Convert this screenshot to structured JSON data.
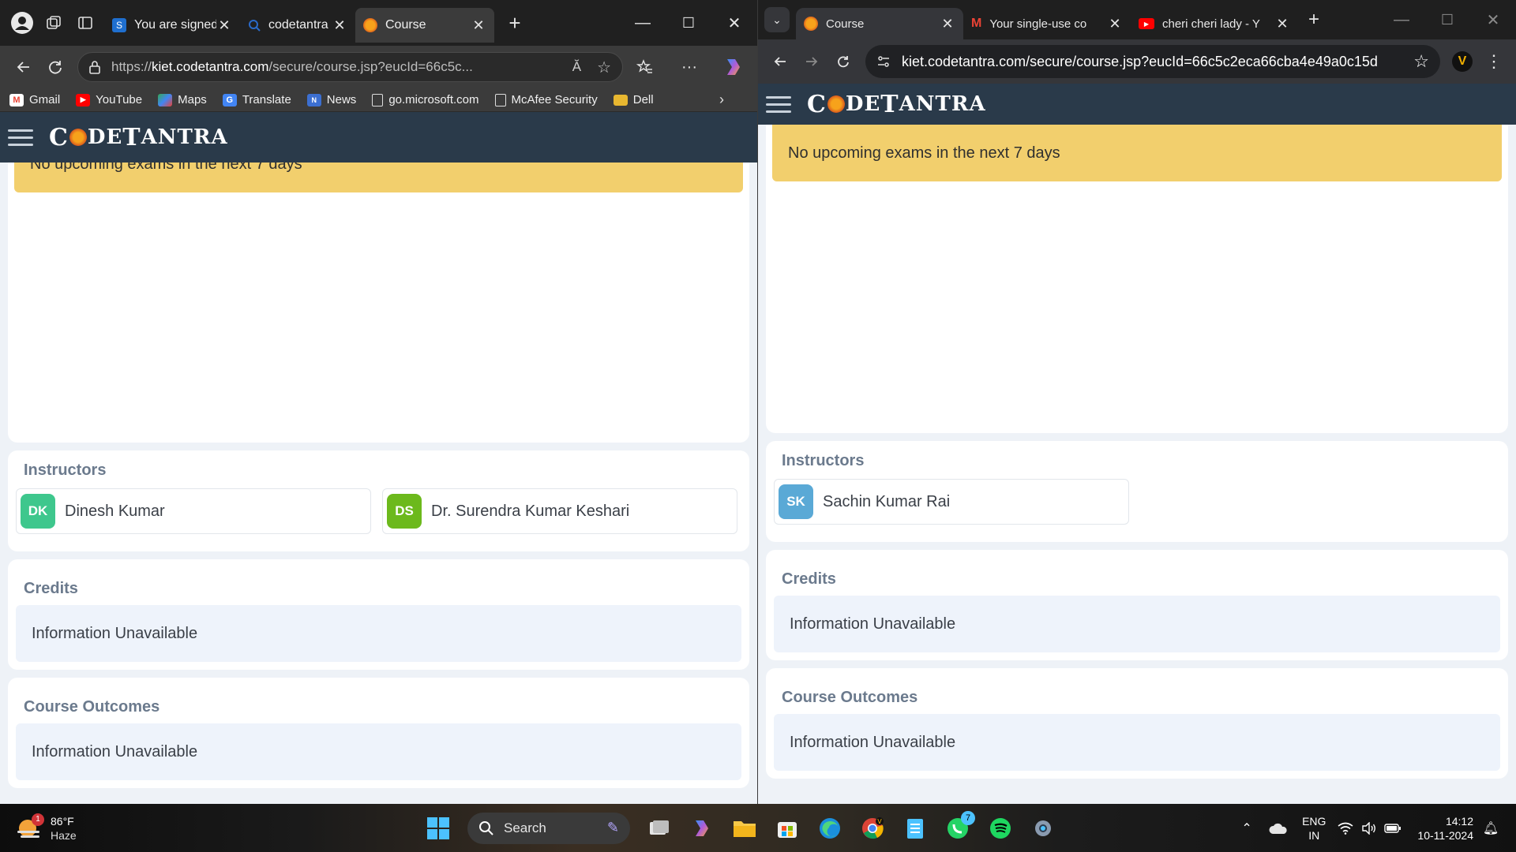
{
  "left_browser": {
    "tabs": [
      {
        "title": "You are signed",
        "favicon": "S",
        "color": "#1f6fcf"
      },
      {
        "title": "codetantra - Se",
        "favicon": "search",
        "color": "#2a6ac9"
      },
      {
        "title": "Course",
        "favicon": "sun",
        "color": "#f7a21b",
        "active": true
      }
    ],
    "url_prefix": "https://",
    "url_domain": "kiet.codetantra.com",
    "url_path": "/secure/course.jsp?eucId=66c5c...",
    "read_aloud_label": "Ă",
    "favorites": [
      {
        "label": "Gmail",
        "icon": "gmail-icon",
        "color": "#ea4335",
        "glyph": "M"
      },
      {
        "label": "YouTube",
        "icon": "youtube-icon",
        "color": "#ff0000",
        "glyph": "▶"
      },
      {
        "label": "Maps",
        "icon": "maps-icon",
        "color": "#34a853",
        "glyph": "◆"
      },
      {
        "label": "Translate",
        "icon": "translate-icon",
        "color": "#4285f4",
        "glyph": "G"
      },
      {
        "label": "News",
        "icon": "news-icon",
        "color": "#3c6fd1",
        "glyph": "N"
      },
      {
        "label": "go.microsoft.com",
        "icon": "page-icon",
        "color": "#3b3b3b",
        "glyph": "□"
      },
      {
        "label": "McAfee Security",
        "icon": "page-icon",
        "color": "#3b3b3b",
        "glyph": "□"
      },
      {
        "label": "Dell",
        "icon": "folder-icon",
        "color": "#e8b730",
        "glyph": ""
      }
    ]
  },
  "right_browser": {
    "tabs": [
      {
        "title": "Course",
        "color": "#f7a21b",
        "active": true
      },
      {
        "title": "Your single-use co",
        "color": "#ea4335"
      },
      {
        "title": "cheri cheri lady - Y",
        "color": "#ff0000"
      }
    ],
    "url": "kiet.codetantra.com/secure/course.jsp?eucId=66c5c2eca66cba4e49a0c15d",
    "profile_initial": "V"
  },
  "site": {
    "logo_text_1": "C",
    "logo_text_2": "DE",
    "logo_text_3": "T",
    "logo_text_4": "ANTRA",
    "banner_text": "No upcoming exams in the next 7 days",
    "instructors_title": "Instructors",
    "credits_title": "Credits",
    "outcomes_title": "Course Outcomes",
    "unavailable": "Information Unavailable"
  },
  "left_instructors": [
    {
      "initials": "DK",
      "name": "Dinesh Kumar",
      "color": "#3ec78d"
    },
    {
      "initials": "DS",
      "name": "Dr. Surendra Kumar Keshari",
      "color": "#6cb91c"
    }
  ],
  "right_instructors": [
    {
      "initials": "SK",
      "name": "Sachin Kumar Rai",
      "color": "#5aa9d6"
    }
  ],
  "taskbar": {
    "weather_temp": "86°F",
    "weather_desc": "Haze",
    "weather_badge": "1",
    "search_label": "Search",
    "whatsapp_badge": "7",
    "lang_1": "ENG",
    "lang_2": "IN",
    "time": "14:12",
    "date": "10-11-2024"
  }
}
